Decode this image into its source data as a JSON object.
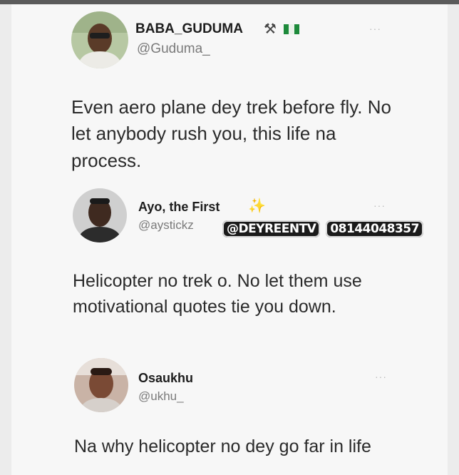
{
  "tweets": [
    {
      "name": "BABA_GUDUMA",
      "badges": [
        "hammer-pick-icon",
        "nigeria-flag-icon"
      ],
      "handle": "@Guduma_",
      "more": "···",
      "text": "Even aero plane dey trek before fly. No let anybody rush you, this life na process."
    },
    {
      "name": "Ayo, the First",
      "badges": [
        "sparkles-icon"
      ],
      "handle": "@aystickz",
      "more": "···",
      "text": "Helicopter no trek o. No let them use motivational quotes tie you down."
    },
    {
      "name": "Osaukhu",
      "badges": [],
      "handle": "@ukhu_",
      "more": "···",
      "text": "Na why helicopter no dey go far in life"
    }
  ],
  "watermark": {
    "brand": "@DEYREENTV",
    "phone": "08144048357"
  },
  "colors": {
    "flag_green": "#1d8a3b",
    "sparkle": "#f2c230",
    "card_bg": "#f7f7f7"
  }
}
